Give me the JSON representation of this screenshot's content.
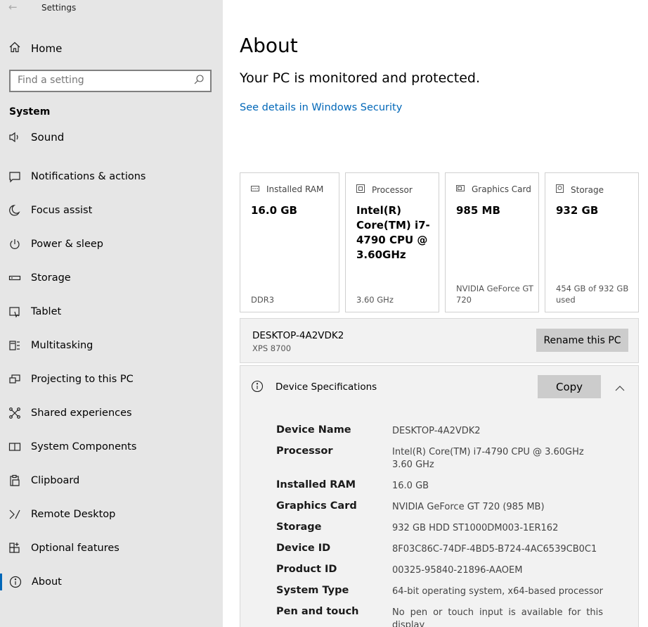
{
  "window": {
    "title": "Settings"
  },
  "sidebar": {
    "home_label": "Home",
    "search_placeholder": "Find a setting",
    "group_label": "System",
    "cutoff_label": "Sound",
    "items": [
      {
        "label": "Notifications & actions",
        "icon": "notifications-icon"
      },
      {
        "label": "Focus assist",
        "icon": "moon-icon"
      },
      {
        "label": "Power & sleep",
        "icon": "power-icon"
      },
      {
        "label": "Storage",
        "icon": "storage-icon"
      },
      {
        "label": "Tablet",
        "icon": "tablet-icon"
      },
      {
        "label": "Multitasking",
        "icon": "multitasking-icon"
      },
      {
        "label": "Projecting to this PC",
        "icon": "projecting-icon"
      },
      {
        "label": "Shared experiences",
        "icon": "shared-icon"
      },
      {
        "label": "System Components",
        "icon": "components-icon"
      },
      {
        "label": "Clipboard",
        "icon": "clipboard-icon"
      },
      {
        "label": "Remote Desktop",
        "icon": "remote-desktop-icon"
      },
      {
        "label": "Optional features",
        "icon": "optional-features-icon"
      },
      {
        "label": "About",
        "icon": "info-icon",
        "active": true
      }
    ]
  },
  "main": {
    "title": "About",
    "status": "Your PC is monitored and protected.",
    "security_link": "See details in Windows Security",
    "cards": [
      {
        "label": "Installed RAM",
        "value": "16.0 GB",
        "sub": "DDR3",
        "icon": "ram-icon"
      },
      {
        "label": "Processor",
        "value": "Intel(R) Core(TM) i7-4790 CPU @ 3.60GHz",
        "sub": "3.60 GHz",
        "icon": "processor-icon"
      },
      {
        "label": "Graphics Card",
        "value": "985 MB",
        "sub": "NVIDIA GeForce GT 720",
        "icon": "graphics-card-icon"
      },
      {
        "label": "Storage",
        "value": "932 GB",
        "sub": "454 GB of 932 GB used",
        "icon": "storage-disk-icon"
      }
    ],
    "pc": {
      "name": "DESKTOP-4A2VDK2",
      "model": "XPS 8700",
      "rename_label": "Rename this PC"
    },
    "specs": {
      "title": "Device Specifications",
      "copy_label": "Copy",
      "rows": [
        {
          "key": "Device Name",
          "value": "DESKTOP-4A2VDK2"
        },
        {
          "key": "Processor",
          "value": "Intel(R) Core(TM) i7-4790 CPU @ 3.60GHz   3.60 GHz"
        },
        {
          "key": "Installed RAM",
          "value": "16.0 GB"
        },
        {
          "key": "Graphics Card",
          "value": "NVIDIA GeForce GT 720 (985 MB)"
        },
        {
          "key": "Storage",
          "value": "932 GB HDD ST1000DM003-1ER162"
        },
        {
          "key": "Device ID",
          "value": "8F03C86C-74DF-4BD5-B724-4AC6539CB0C1"
        },
        {
          "key": "Product ID",
          "value": "00325-95840-21896-AAOEM"
        },
        {
          "key": "System Type",
          "value": "64-bit operating system, x64-based processor"
        },
        {
          "key": "Pen and touch",
          "value": "No pen or touch input is available for this display"
        }
      ]
    }
  }
}
